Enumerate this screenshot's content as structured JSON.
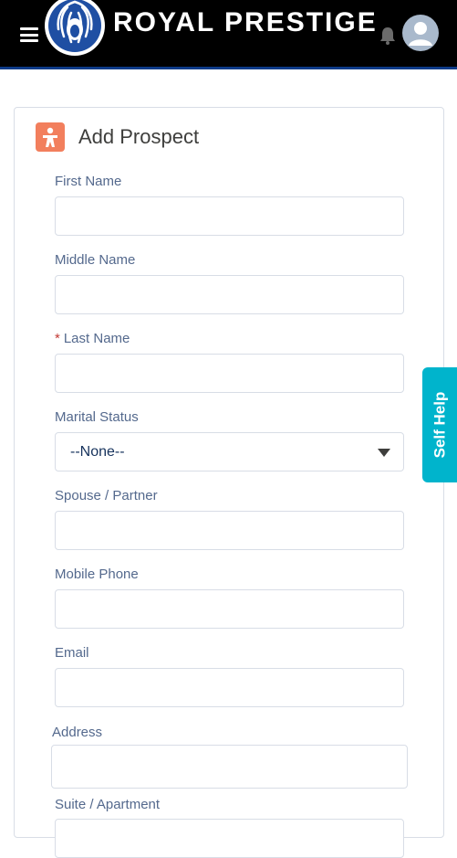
{
  "header": {
    "brand": "ROYAL PRESTIGE",
    "icons": [
      "menu-icon",
      "lion-logo",
      "bell-icon",
      "user-avatar-icon"
    ],
    "colors": {
      "bar": "#000000",
      "accent": "#0b3a88"
    }
  },
  "card": {
    "title": "Add Prospect",
    "icon": "person-icon",
    "icon_color": "#f27f5d"
  },
  "form": {
    "first_name_label": "First Name",
    "first_name_value": "",
    "middle_name_label": "Middle Name",
    "middle_name_value": "",
    "last_name_required": "*",
    "last_name_label": "Last Name",
    "last_name_value": "",
    "marital_status_label": "Marital Status",
    "marital_status_value": "--None--",
    "spouse_label": "Spouse / Partner",
    "spouse_value": "",
    "mobile_label": "Mobile Phone",
    "mobile_value": "",
    "email_label": "Email",
    "email_value": "",
    "address_label": "Address",
    "address_value": "",
    "suite_label": "Suite / Apartment"
  },
  "self_help": {
    "label": "Self Help",
    "color": "#00b4cc"
  }
}
